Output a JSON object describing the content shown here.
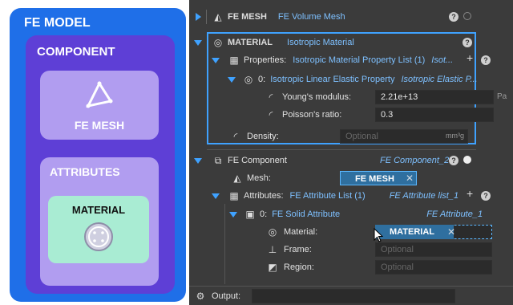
{
  "diagram": {
    "model_title": "FE MODEL",
    "component_title": "COMPONENT",
    "mesh_label": "FE MESH",
    "attributes_title": "ATTRIBUTES",
    "material_label": "MATERIAL",
    "colors": {
      "model": "#1f6fe8",
      "component": "#5e3fd6",
      "box": "#b19df0",
      "material": "#a9ecd3"
    }
  },
  "panel": {
    "fe_mesh": {
      "title": "FE MESH",
      "type": "FE Volume Mesh"
    },
    "material": {
      "title": "MATERIAL",
      "type": "Isotropic Material",
      "properties_label": "Properties:",
      "properties_value": "Isotropic Material Property List (1)",
      "properties_type": "Isot...",
      "item_index": "0:",
      "item_value": "Isotropic Linear Elastic Property",
      "item_type": "Isotropic Elastic P...",
      "youngs_label": "Young's modulus:",
      "youngs_value": "2.21e+13",
      "youngs_unit": "Pa",
      "poisson_label": "Poisson's ratio:",
      "poisson_value": "0.3",
      "density_label": "Density:",
      "density_placeholder": "Optional",
      "density_unit": "mm³g"
    },
    "component": {
      "title": "FE Component",
      "type": "FE Component_2",
      "mesh_label": "Mesh:",
      "mesh_value": "FE MESH",
      "attributes_label": "Attributes:",
      "attributes_value": "FE Attribute List (1)",
      "attributes_type": "FE Attribute list_1",
      "solid_index": "0:",
      "solid_value": "FE Solid Attribute",
      "solid_type": "FE Attribute_1",
      "material_label": "Material:",
      "material_value": "MATERIAL",
      "frame_label": "Frame:",
      "frame_placeholder": "Optional",
      "region_label": "Region:",
      "region_placeholder": "Optional"
    },
    "output_label": "Output:",
    "help_glyph": "?",
    "plus_glyph": "+",
    "remove_glyph": "✕",
    "accent": "#3fa2ff"
  }
}
